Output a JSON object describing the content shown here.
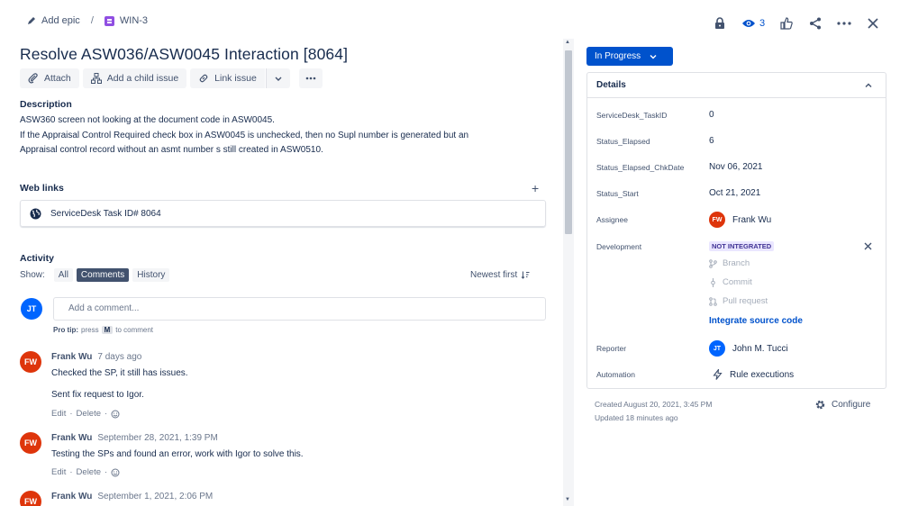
{
  "breadcrumb": {
    "epic_label": "Add epic",
    "separator": "/",
    "issue_key": "WIN-3"
  },
  "top_actions": {
    "watch_count": "3"
  },
  "issue": {
    "title": "Resolve ASW036/ASW0045 Interaction [8064]"
  },
  "toolbar": {
    "attach": "Attach",
    "add_child": "Add a child issue",
    "link_issue": "Link issue"
  },
  "description": {
    "heading": "Description",
    "lines": [
      "ASW360 screen not looking at the document code in ASW0045.",
      "If the Appraisal Control Required check box in ASW0045 is unchecked, then no Supl number is generated but an",
      "Appraisal control record without an asmt number s still created in ASW0510."
    ]
  },
  "web_links": {
    "heading": "Web links",
    "add": "+",
    "link_text": "ServiceDesk Task ID# 8064"
  },
  "activity": {
    "heading": "Activity",
    "show_label": "Show:",
    "filters": [
      "All",
      "Comments",
      "History"
    ],
    "active_filter": "Comments",
    "sort_label": "Newest first",
    "current_user_initials": "JT",
    "comment_placeholder": "Add a comment...",
    "protip_bold": "Pro tip:",
    "protip_press": "press",
    "protip_key": "M",
    "protip_suffix": "to comment"
  },
  "comments": [
    {
      "initials": "FW",
      "author": "Frank Wu",
      "time": "7 days ago",
      "body": [
        "Checked the SP, it still has issues.",
        "Sent fix request to Igor."
      ],
      "edit": "Edit",
      "delete": "Delete",
      "dot": "·"
    },
    {
      "initials": "FW",
      "author": "Frank Wu",
      "time": "September 28, 2021, 1:39 PM",
      "body": [
        "Testing the SPs and found an error, work with Igor to solve this."
      ],
      "edit": "Edit",
      "delete": "Delete",
      "dot": "·"
    },
    {
      "initials": "FW",
      "author": "Frank Wu",
      "time": "September 1, 2021, 2:06 PM"
    }
  ],
  "status": {
    "label": "In Progress"
  },
  "details": {
    "heading": "Details",
    "fields": [
      {
        "label": "ServiceDesk_TaskID",
        "value": "0"
      },
      {
        "label": "Status_Elapsed",
        "value": "6"
      },
      {
        "label": "Status_Elapsed_ChkDate",
        "value": "Nov 06, 2021"
      },
      {
        "label": "Status_Start",
        "value": "Oct 21, 2021"
      },
      {
        "label": "Assignee",
        "value": "Frank Wu",
        "initials": "FW"
      },
      {
        "label": "Development",
        "value": "NOT INTEGRATED"
      },
      {
        "label": "Reporter",
        "value": "John M. Tucci",
        "initials": "JT"
      },
      {
        "label": "Automation",
        "value": "Rule executions"
      }
    ],
    "development_items": [
      "Branch",
      "Commit",
      "Pull request"
    ],
    "integrate_link": "Integrate source code"
  },
  "footer": {
    "created": "Created August 20, 2021, 3:45 PM",
    "updated": "Updated 18 minutes ago",
    "configure": "Configure"
  },
  "colors": {
    "primary": "#0052cc",
    "avatar_fw": "#de350b",
    "avatar_jt": "#0065ff",
    "lozenge_bg": "#eae6ff"
  }
}
